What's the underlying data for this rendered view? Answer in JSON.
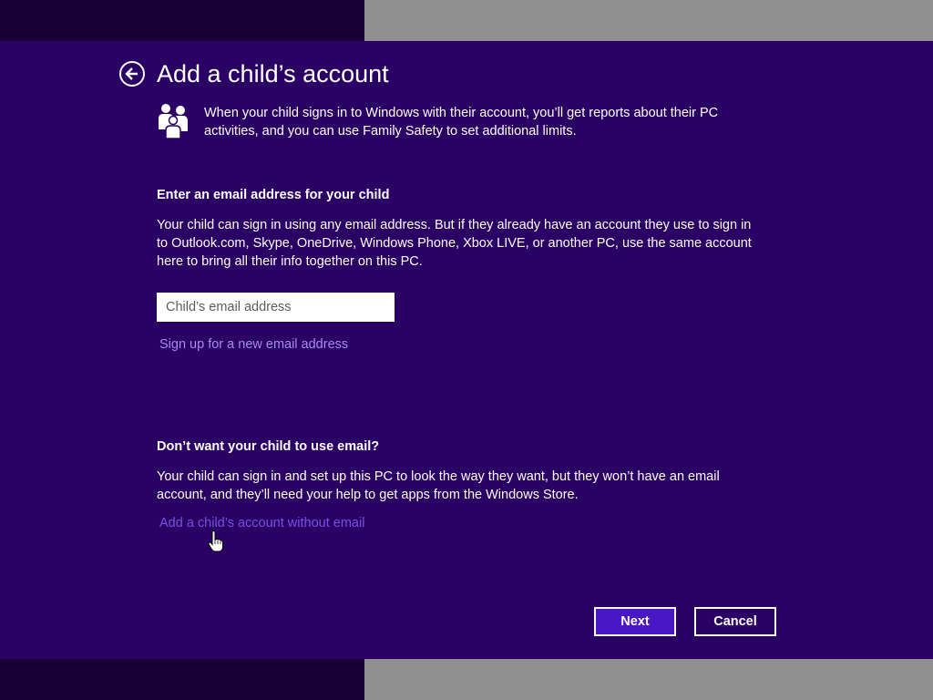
{
  "header": {
    "title": "Add a child’s account",
    "intro": "When your child signs in to Windows with their account, you’ll get reports about their PC activities, and you can use Family Safety to set additional limits."
  },
  "email_section": {
    "heading": "Enter an email address for your child",
    "description": "Your child can sign in using any email address. But if they already have an account they use to sign in to Outlook.com, Skype, OneDrive, Windows Phone, Xbox LIVE, or another PC, use the same account here to bring all their info together on this PC.",
    "input_value": "",
    "input_placeholder": "Child’s email address",
    "signup_link": "Sign up for a new email address"
  },
  "no_email_section": {
    "heading": "Don’t want your child to use email?",
    "description": "Your child can sign in and set up this PC to look the way they want, but they won’t have an email account, and they’ll need your help to get apps from the Windows Store.",
    "link": "Add a child’s account without email"
  },
  "buttons": {
    "next": "Next",
    "cancel": "Cancel"
  },
  "icons": {
    "back": "back-arrow-icon",
    "family": "family-people-icon",
    "cursor": "hand-pointer-icon"
  },
  "colors": {
    "background": "#2a0064",
    "accent": "#4a17c4",
    "link": "#a78af5"
  }
}
